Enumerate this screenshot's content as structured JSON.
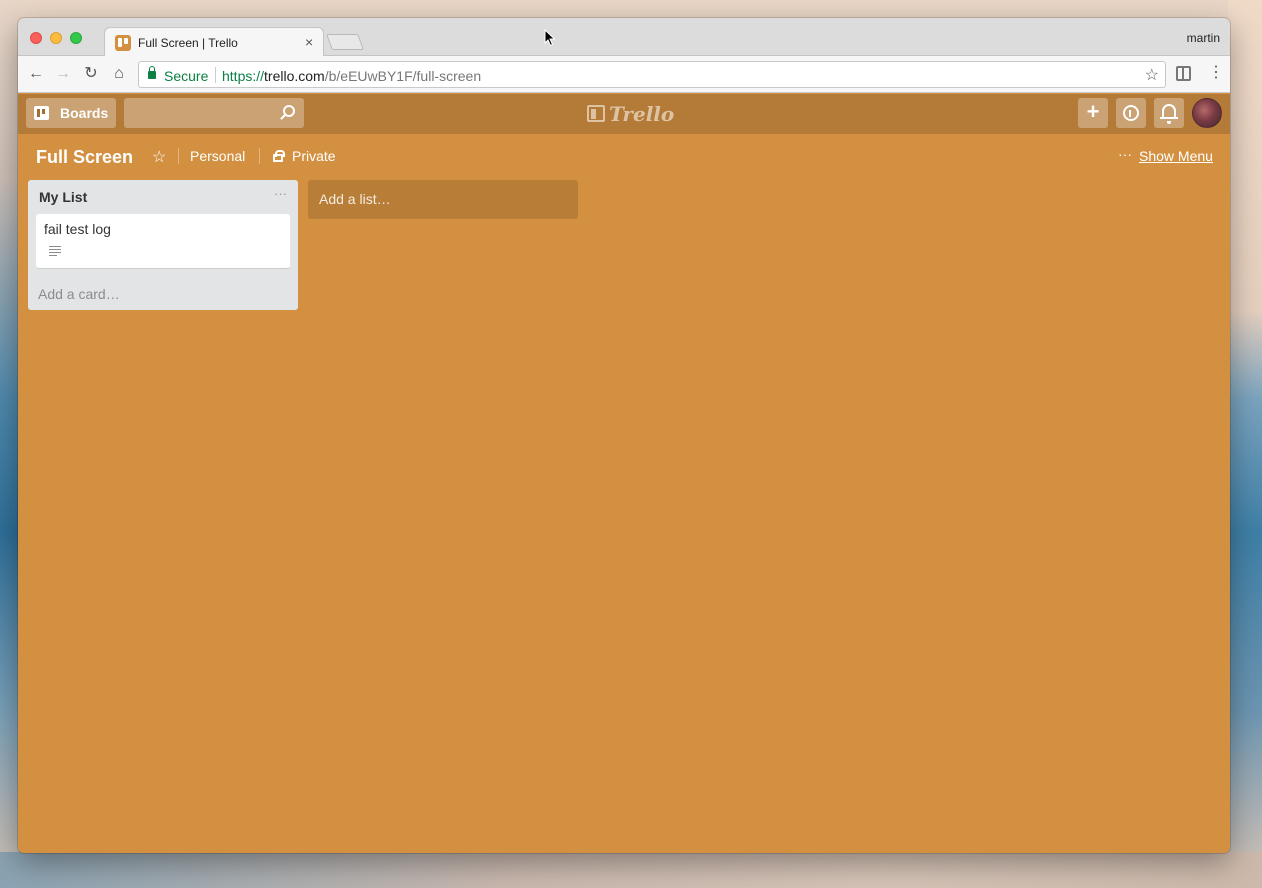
{
  "browser": {
    "tab": {
      "title": "Full Screen | Trello",
      "close": "×"
    },
    "profile_name": "martin",
    "omnibox": {
      "secure_label": "Secure",
      "url_scheme": "https://",
      "url_host": "trello.com",
      "url_path": "/b/eEUwBY1F/full-screen"
    },
    "icons": {
      "back": "←",
      "forward": "→",
      "reload": "↻",
      "home": "⌂",
      "bookmark_star": "☆",
      "menu": "⋮"
    }
  },
  "trello": {
    "header": {
      "boards_label": "Boards",
      "logo_text": "Trello",
      "plus": "+"
    },
    "board": {
      "title": "Full Screen",
      "star": "☆",
      "team": "Personal",
      "visibility": "Private",
      "menu_dots": "···",
      "show_menu": "Show Menu"
    },
    "lists": [
      {
        "title": "My List",
        "menu": "···",
        "cards": [
          {
            "title": "fail test log",
            "has_description": true
          }
        ],
        "add_card": "Add a card…"
      }
    ],
    "add_list": "Add a list…"
  },
  "colors": {
    "board_background": "#d29040",
    "header_background": "#b47a37",
    "secure_green": "#0b8043"
  }
}
